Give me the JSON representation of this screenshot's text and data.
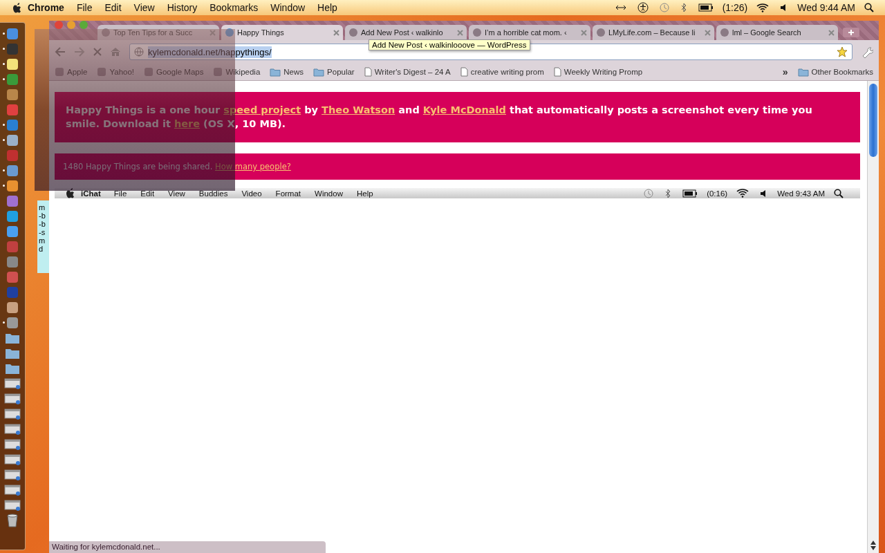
{
  "menu_bar": {
    "app": "Chrome",
    "menus": [
      "File",
      "Edit",
      "View",
      "History",
      "Bookmarks",
      "Window",
      "Help"
    ],
    "battery_time": "(1:26)",
    "clock": "Wed 9:44 AM"
  },
  "dock": [
    {
      "kind": "app",
      "running": true
    },
    {
      "kind": "app",
      "running": true
    },
    {
      "kind": "app",
      "running": true
    },
    {
      "kind": "app",
      "running": true
    },
    {
      "kind": "app",
      "running": false
    },
    {
      "kind": "app",
      "running": false
    },
    {
      "kind": "app",
      "running": true
    },
    {
      "kind": "app",
      "running": true
    },
    {
      "kind": "app",
      "running": false
    },
    {
      "kind": "app",
      "running": true
    },
    {
      "kind": "app",
      "running": true
    },
    {
      "kind": "app",
      "running": false
    },
    {
      "kind": "app",
      "running": false
    },
    {
      "kind": "app",
      "running": false
    },
    {
      "kind": "app",
      "running": false
    },
    {
      "kind": "app",
      "running": false
    },
    {
      "kind": "app",
      "running": false
    },
    {
      "kind": "app",
      "running": false
    },
    {
      "kind": "app",
      "running": false
    },
    {
      "kind": "app",
      "running": true
    },
    {
      "kind": "folder",
      "running": false
    },
    {
      "kind": "folder",
      "running": false
    },
    {
      "kind": "folder",
      "running": false
    },
    {
      "kind": "window",
      "running": false
    },
    {
      "kind": "window",
      "running": false
    },
    {
      "kind": "window",
      "running": false
    },
    {
      "kind": "window",
      "running": false
    },
    {
      "kind": "window",
      "running": false
    },
    {
      "kind": "window",
      "running": false
    },
    {
      "kind": "window",
      "running": false
    },
    {
      "kind": "window",
      "running": false
    },
    {
      "kind": "window",
      "running": false
    },
    {
      "kind": "trash",
      "running": false
    }
  ],
  "sticky_note": {
    "lines": [
      "m",
      "-b",
      "-b",
      "-s",
      "m",
      "d"
    ]
  },
  "browser": {
    "tabs": [
      {
        "title": "Top Ten Tips for a Succ",
        "selected": false
      },
      {
        "title": "Happy Things",
        "selected": true
      },
      {
        "title": "Add New Post ‹ walkinlo",
        "selected": false
      },
      {
        "title": "I’m a horrible cat mom. ‹",
        "selected": false
      },
      {
        "title": "LMyLife.com – Because li",
        "selected": false
      },
      {
        "title": "lml – Google Search",
        "selected": false
      }
    ],
    "tooltip": "Add New Post ‹ walkinlooove — WordPress",
    "address": {
      "text": "kylemcdonald.net/happythings/",
      "selected": true
    },
    "bookmarks": [
      {
        "label": "Apple",
        "kind": "site"
      },
      {
        "label": "Yahoo!",
        "kind": "site"
      },
      {
        "label": "Google Maps",
        "kind": "site"
      },
      {
        "label": "Wikipedia",
        "kind": "site"
      },
      {
        "label": "News",
        "kind": "folder"
      },
      {
        "label": "Popular",
        "kind": "folder"
      },
      {
        "label": "Writer's Digest – 24 A",
        "kind": "page"
      },
      {
        "label": "creative writing prom",
        "kind": "page"
      },
      {
        "label": "Weekly Writing Promp",
        "kind": "page"
      }
    ],
    "overflow": "»",
    "other_bookmarks": "Other Bookmarks"
  },
  "page": {
    "intro": [
      {
        "kind": "bold",
        "text": "Happy Things"
      },
      {
        "kind": "plain",
        "text": " is a one hour "
      },
      {
        "kind": "link",
        "text": "speed project"
      },
      {
        "kind": "plain",
        "text": " by "
      },
      {
        "kind": "link",
        "text": "Theo Watson"
      },
      {
        "kind": "plain",
        "text": " and "
      },
      {
        "kind": "link",
        "text": "Kyle McDonald"
      },
      {
        "kind": "plain",
        "text": " that automatically posts a screenshot every time you smile. Download it "
      },
      {
        "kind": "link",
        "text": "here"
      },
      {
        "kind": "plain",
        "text": " (OS X, 10 MB)."
      }
    ],
    "counter": [
      {
        "kind": "plain",
        "text": "1480 Happy Things are being shared. "
      },
      {
        "kind": "link",
        "text": "How many people?"
      }
    ],
    "screenshot_menu": {
      "app": "iChat",
      "menus": [
        "File",
        "Edit",
        "View",
        "Buddies",
        "Video",
        "Format",
        "Window",
        "Help"
      ],
      "battery_time": "(0:16)",
      "clock": "Wed 9:43 AM"
    }
  },
  "status": "Waiting for kylemcdonald.net..."
}
